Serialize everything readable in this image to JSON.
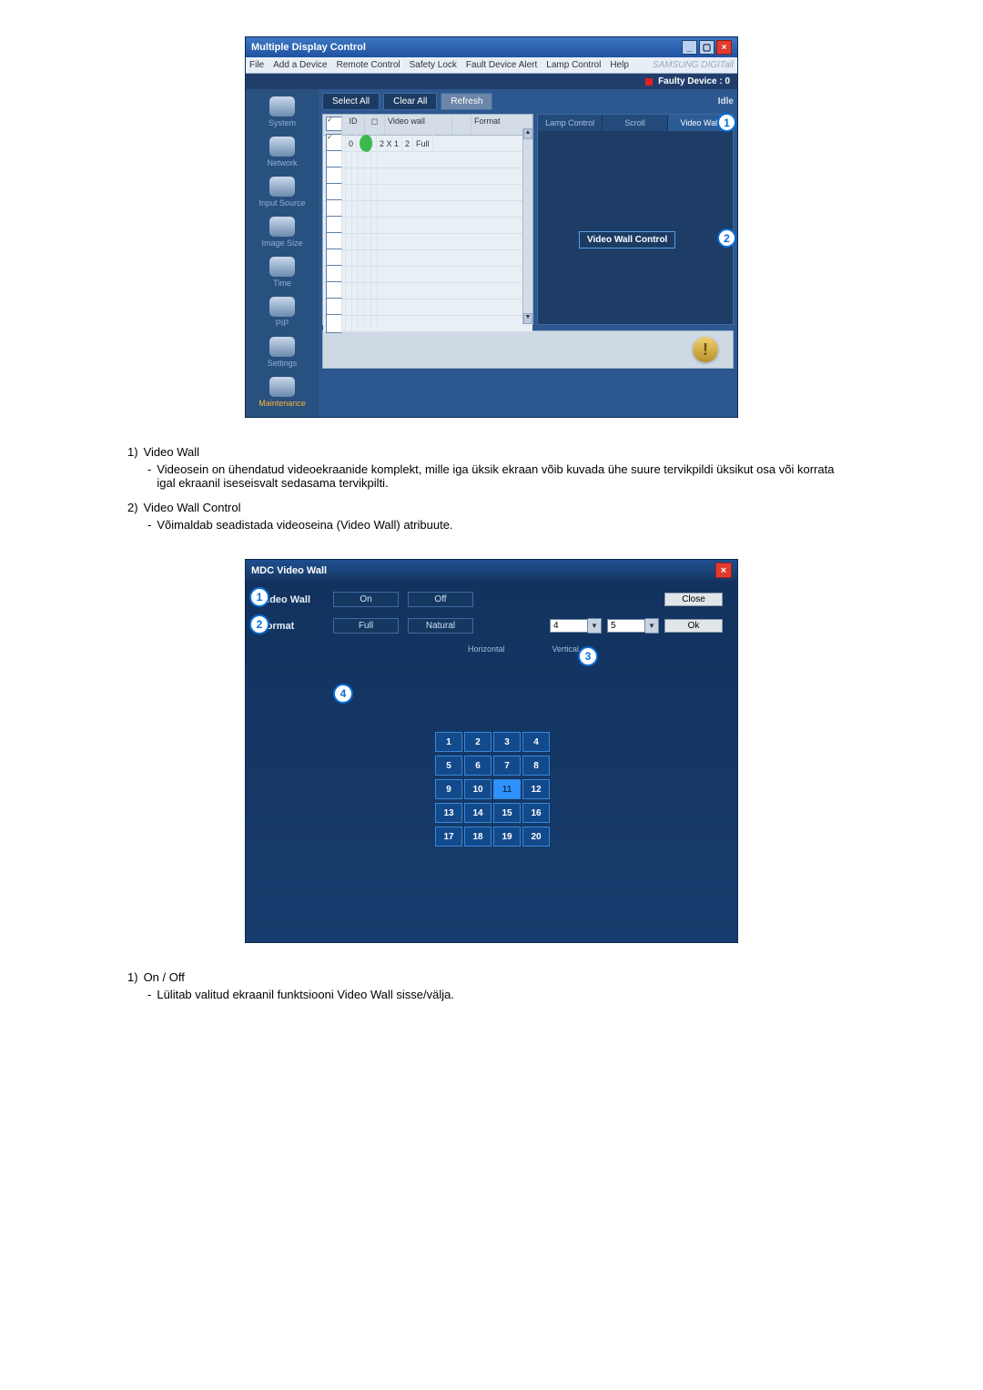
{
  "win1": {
    "title": "Multiple Display Control",
    "menu": [
      "File",
      "Add a Device",
      "Remote Control",
      "Safety Lock",
      "Fault Device Alert",
      "Lamp Control",
      "Help"
    ],
    "brand": "SAMSUNG DIGITall",
    "faulty": "Faulty Device : 0",
    "sidebar": [
      {
        "label": "System"
      },
      {
        "label": "Network"
      },
      {
        "label": "Input Source"
      },
      {
        "label": "Image Size"
      },
      {
        "label": "Time"
      },
      {
        "label": "PIP"
      },
      {
        "label": "Settings"
      },
      {
        "label": "Maintenance",
        "active": true
      }
    ],
    "toolbar": {
      "select_all": "Select All",
      "clear_all": "Clear All",
      "refresh": "Refresh",
      "idle": "Idle"
    },
    "table": {
      "headers": {
        "chk": "",
        "id_col": "ID",
        "stat": "",
        "vw": "Video wall",
        "n": "",
        "fmt": "Format"
      },
      "row": {
        "id": "0",
        "vw": "2 X 1",
        "n": "2",
        "fmt": "Full"
      }
    },
    "tabs": [
      "Lamp Control",
      "Scroll",
      "Video Wall"
    ],
    "vwc_btn": "Video Wall Control",
    "callouts": {
      "one": "1",
      "two": "2"
    }
  },
  "defs1": [
    {
      "num": "1)",
      "title": "Video Wall",
      "desc": "Videosein on ühendatud videoekraanide komplekt, mille iga üksik ekraan võib kuvada ühe suure tervikpildi üksikut osa või korrata igal ekraanil iseseisvalt sedasama tervikpilti."
    },
    {
      "num": "2)",
      "title": "Video Wall Control",
      "desc": "Võimaldab seadistada videoseina (Video Wall) atribuute."
    }
  ],
  "win2": {
    "title": "MDC Video Wall",
    "row1": {
      "label": "Video Wall",
      "on": "On",
      "off": "Off"
    },
    "row2": {
      "label": "Format",
      "full": "Full",
      "natural": "Natural"
    },
    "close": "Close",
    "ok": "Ok",
    "h_val": "4",
    "v_val": "5",
    "h_lbl": "Horizontal",
    "v_lbl": "Vertical",
    "cells": [
      "1",
      "2",
      "3",
      "4",
      "5",
      "6",
      "7",
      "8",
      "9",
      "10",
      "11",
      "12",
      "13",
      "14",
      "15",
      "16",
      "17",
      "18",
      "19",
      "20"
    ],
    "selected": 11,
    "callouts": {
      "one": "1",
      "two": "2",
      "three": "3",
      "four": "4"
    }
  },
  "defs2": [
    {
      "num": "1)",
      "title": "On / Off",
      "desc": "Lülitab valitud ekraanil funktsiooni Video Wall sisse/välja."
    }
  ]
}
